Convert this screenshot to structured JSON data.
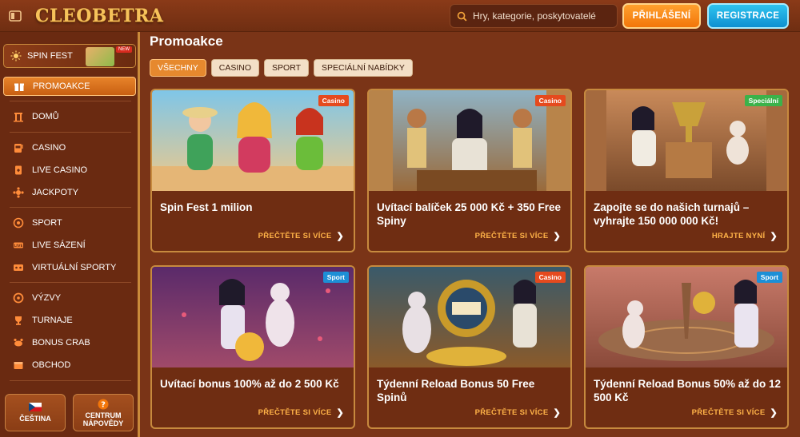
{
  "header": {
    "logo": "CLEOBETRA",
    "search_placeholder": "Hry, kategorie, poskytovatelé",
    "login_label": "PŘIHLÁŠENÍ",
    "register_label": "REGISTRACE"
  },
  "sidebar": {
    "spinfest": {
      "label": "SPIN FEST",
      "badge": "NEW"
    },
    "items": [
      {
        "label": "PROMOAKCE",
        "icon": "gift-icon"
      },
      {
        "label": "DOMŮ",
        "icon": "home-icon"
      },
      {
        "label": "CASINO",
        "icon": "slot-machine-icon"
      },
      {
        "label": "LIVE CASINO",
        "icon": "cards-icon"
      },
      {
        "label": "JACKPOTY",
        "icon": "jackpot-icon"
      },
      {
        "label": "SPORT",
        "icon": "ball-icon"
      },
      {
        "label": "LIVE SÁZENÍ",
        "icon": "live-icon"
      },
      {
        "label": "VIRTUÁLNÍ SPORTY",
        "icon": "virtual-icon"
      },
      {
        "label": "VÝZVY",
        "icon": "challenge-icon"
      },
      {
        "label": "TURNAJE",
        "icon": "trophy-icon"
      },
      {
        "label": "BONUS CRAB",
        "icon": "crab-icon"
      },
      {
        "label": "OBCHOD",
        "icon": "shop-icon"
      }
    ],
    "language_label": "ČEŠTINA",
    "help_label": "CENTRUM NÁPOVĚDY"
  },
  "main": {
    "title": "Promoakce",
    "filters": [
      "VŠECHNY",
      "CASINO",
      "SPORT",
      "SPECIÁLNÍ NABÍDKY"
    ],
    "cards": [
      {
        "tag": "Casino",
        "title": "Spin Fest 1 milion",
        "cta": "PŘEČTĚTE SI VÍCE"
      },
      {
        "tag": "Casino",
        "title": "Uvítací balíček 25 000 Kč + 350 Free Spiny",
        "cta": "PŘEČTĚTE SI VÍCE"
      },
      {
        "tag": "Speciální",
        "title": "Zapojte se do našich turnajů – vyhrajte 150 000 000 Kč!",
        "cta": "HRAJTE NYNÍ"
      },
      {
        "tag": "Sport",
        "title": "Uvítací bonus 100% až do 2 500 Kč",
        "cta": "PŘEČTĚTE SI VÍCE"
      },
      {
        "tag": "Casino",
        "title": "Týdenní Reload Bonus 50 Free Spinů",
        "cta": "PŘEČTĚTE SI VÍCE"
      },
      {
        "tag": "Sport",
        "title": "Týdenní Reload Bonus 50% až do 12 500 Kč",
        "cta": "PŘEČTĚTE SI VÍCE"
      }
    ]
  },
  "colors": {
    "background": "#7a3417",
    "accent_orange": "#f2760a",
    "accent_blue": "#0e8fd0",
    "cta_text": "#ffb348"
  }
}
